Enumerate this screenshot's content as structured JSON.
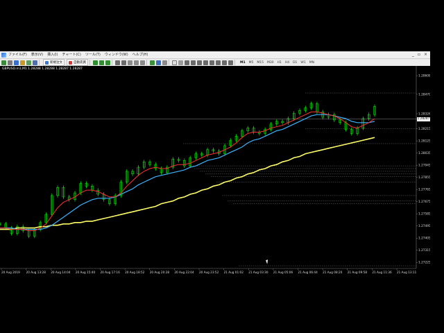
{
  "menu": {
    "items": [
      "ファイル(F)",
      "表示(V)",
      "挿入(I)",
      "チャート(C)",
      "ツール(T)",
      "ウィンドウ(W)",
      "ヘルプ(H)"
    ],
    "window_controls": [
      "_",
      "▫",
      "×"
    ]
  },
  "toolbar": {
    "new_order_label": "新規注文",
    "auto_trade_label": "自動売買",
    "timeframes": [
      "M1",
      "M5",
      "M15",
      "M30",
      "H1",
      "H4",
      "D1",
      "W1",
      "MN"
    ],
    "active_timeframe": "M1"
  },
  "chart": {
    "title": "GBPUSD.m1,M1  1.28288 1.28288 1.28287 1.28287",
    "current_price": "1.28287",
    "colors": {
      "background": "#000000",
      "candles": "#00ff00",
      "ma_fast": "#ff3030",
      "ma_mid": "#3ab4ff",
      "ma_slow": "#ffff66",
      "grid_dashed": "#8a8a8a"
    }
  },
  "chart_data": {
    "type": "line",
    "symbol": "GBPUSD",
    "timeframe": "M1",
    "y_ticks": [
      "1.28608",
      "1.28470",
      "1.28326",
      "1.28215",
      "1.28125",
      "1.28035",
      "1.27945",
      "1.27855",
      "1.27765",
      "1.27675",
      "1.27585",
      "1.27495",
      "1.27405",
      "1.27315",
      "1.27225"
    ],
    "x_ticks": [
      "20 Aug 2019",
      "20 Aug 13:28",
      "20 Aug 14:04",
      "20 Aug 15:40",
      "20 Aug 17:16",
      "20 Aug 18:52",
      "20 Aug 20:28",
      "20 Aug 22:04",
      "20 Aug 23:52",
      "21 Aug 01:02",
      "21 Aug 03:30",
      "21 Aug 05:06",
      "21 Aug 06:44",
      "21 Aug 08:20",
      "21 Aug 09:58",
      "21 Aug 11:36",
      "21 Aug 13:11"
    ],
    "ylim": [
      1.2718,
      1.2866
    ],
    "price_series": [
      1.2751,
      1.2748,
      1.2744,
      1.2749,
      1.2746,
      1.2742,
      1.2747,
      1.2752,
      1.2758,
      1.2772,
      1.2778,
      1.2771,
      1.2769,
      1.2774,
      1.2781,
      1.2779,
      1.2776,
      1.2773,
      1.2769,
      1.2766,
      1.2772,
      1.2782,
      1.279,
      1.2788,
      1.2793,
      1.2797,
      1.2795,
      1.2792,
      1.2789,
      1.2793,
      1.2799,
      1.2798,
      1.2794,
      1.28,
      1.2803,
      1.2802,
      1.2806,
      1.2805,
      1.2803,
      1.2809,
      1.2813,
      1.2816,
      1.282,
      1.2822,
      1.2819,
      1.2818,
      1.2821,
      1.2825,
      1.2827,
      1.2826,
      1.2829,
      1.2833,
      1.2835,
      1.2837,
      1.284,
      1.2834,
      1.283,
      1.2832,
      1.2828,
      1.2826,
      1.2821,
      1.2818,
      1.2822,
      1.2829,
      1.2832,
      1.2838
    ],
    "ma_fast": [
      1.2748,
      1.2748,
      1.2747,
      1.2747,
      1.2747,
      1.2746,
      1.2746,
      1.2748,
      1.2751,
      1.2757,
      1.2763,
      1.2767,
      1.2769,
      1.2771,
      1.2774,
      1.2776,
      1.2776,
      1.2775,
      1.2773,
      1.2771,
      1.2771,
      1.2774,
      1.2779,
      1.2783,
      1.2787,
      1.279,
      1.2792,
      1.2793,
      1.2792,
      1.2792,
      1.2794,
      1.2795,
      1.2795,
      1.2796,
      1.2798,
      1.28,
      1.2802,
      1.2803,
      1.2804,
      1.2806,
      1.2808,
      1.2811,
      1.2815,
      1.2818,
      1.2819,
      1.2819,
      1.282,
      1.2822,
      1.2823,
      1.2824,
      1.2826,
      1.2828,
      1.283,
      1.2832,
      1.2834,
      1.2834,
      1.2833,
      1.2832,
      1.2831,
      1.2829,
      1.2826,
      1.2823,
      1.2822,
      1.2824,
      1.2826,
      1.2829
    ],
    "ma_mid": [
      1.2748,
      1.2748,
      1.2748,
      1.2747,
      1.2747,
      1.2747,
      1.2747,
      1.2747,
      1.2748,
      1.275,
      1.2753,
      1.2756,
      1.2759,
      1.2762,
      1.2765,
      1.2767,
      1.2769,
      1.277,
      1.277,
      1.277,
      1.2771,
      1.2773,
      1.2775,
      1.2777,
      1.278,
      1.2782,
      1.2784,
      1.2786,
      1.2787,
      1.2788,
      1.2789,
      1.279,
      1.2791,
      1.2793,
      1.2794,
      1.2796,
      1.2798,
      1.2799,
      1.28,
      1.2802,
      1.2804,
      1.2806,
      1.2808,
      1.2811,
      1.2813,
      1.2814,
      1.2816,
      1.2818,
      1.282,
      1.2821,
      1.2823,
      1.2825,
      1.2827,
      1.2829,
      1.2831,
      1.2832,
      1.2832,
      1.2832,
      1.2831,
      1.283,
      1.2829,
      1.2827,
      1.2826,
      1.2826,
      1.2826,
      1.2827
    ],
    "ma_slow": [
      1.2747,
      1.2747,
      1.2747,
      1.2748,
      1.2748,
      1.2748,
      1.2748,
      1.2749,
      1.2749,
      1.275,
      1.275,
      1.2751,
      1.2751,
      1.2752,
      1.2752,
      1.2753,
      1.2753,
      1.2754,
      1.2755,
      1.2756,
      1.2757,
      1.2758,
      1.2759,
      1.276,
      1.2761,
      1.2762,
      1.2763,
      1.2764,
      1.2766,
      1.2767,
      1.2768,
      1.277,
      1.2771,
      1.2773,
      1.2774,
      1.2776,
      1.2777,
      1.2779,
      1.278,
      1.2782,
      1.2783,
      1.2785,
      1.2786,
      1.2788,
      1.2789,
      1.2791,
      1.2792,
      1.2794,
      1.2795,
      1.2797,
      1.2798,
      1.28,
      1.2801,
      1.2803,
      1.2804,
      1.2805,
      1.2806,
      1.2807,
      1.2808,
      1.2809,
      1.281,
      1.2811,
      1.2812,
      1.2813,
      1.2814,
      1.2815
    ],
    "horizontal_levels": [
      1.28287,
      1.2848,
      1.28215,
      1.28105,
      1.2794,
      1.2792,
      1.279,
      1.2788,
      1.2786,
      1.2782,
      1.2772,
      1.2768,
      1.2766,
      1.272
    ],
    "grid": false,
    "legend": "none"
  }
}
